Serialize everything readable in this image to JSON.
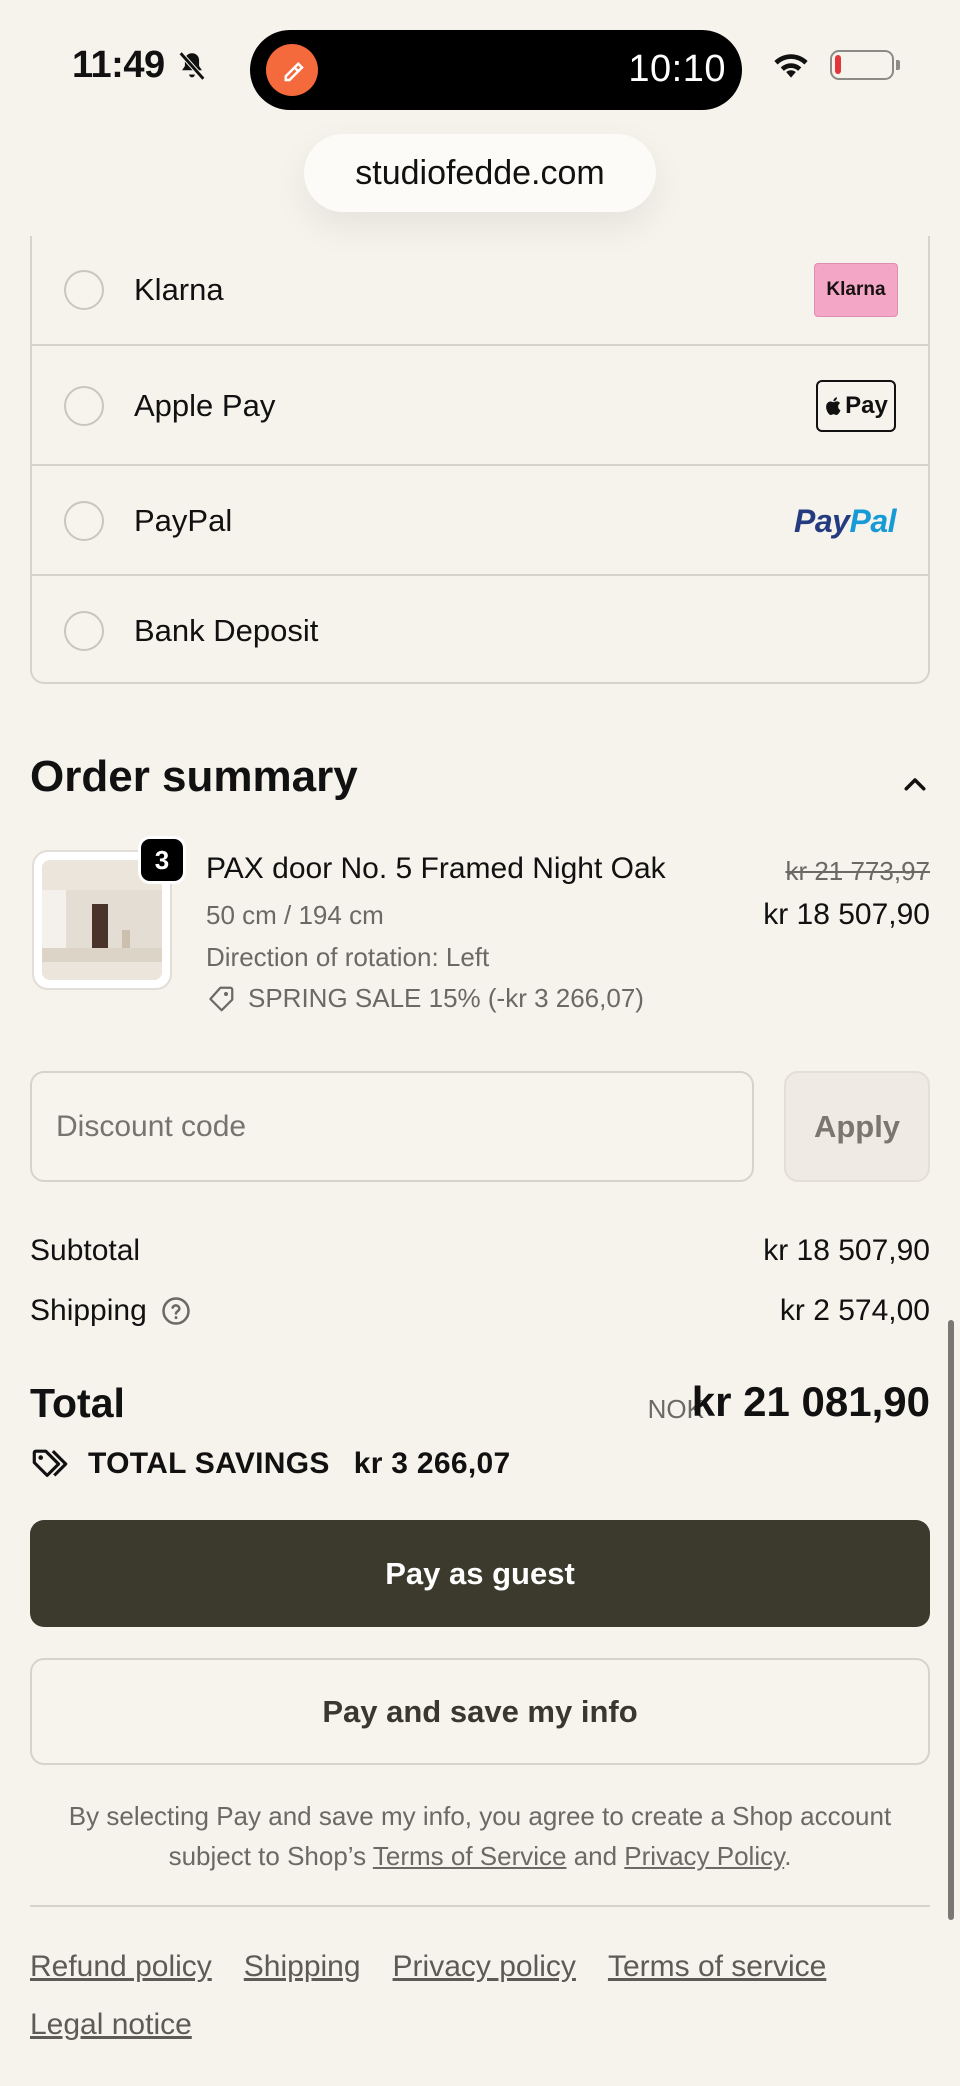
{
  "status_bar": {
    "time": "11:49",
    "timer": "10:10"
  },
  "browser": {
    "url": "studiofedde.com"
  },
  "payment": {
    "methods": [
      {
        "label": "Klarna",
        "badge": "Klarna"
      },
      {
        "label": "Apple Pay",
        "badge": "Pay"
      },
      {
        "label": "PayPal",
        "badge_a": "Pay",
        "badge_b": "Pal"
      },
      {
        "label": "Bank Deposit"
      }
    ]
  },
  "summary": {
    "title": "Order summary",
    "item": {
      "quantity": "3",
      "name": "PAX door No. 5 Framed Night Oak",
      "size": "50 cm / 194 cm",
      "direction": "Direction of rotation: Left",
      "discount": "SPRING SALE 15% (-kr 3 266,07)",
      "price_original": "kr 21 773,97",
      "price_final": "kr 18 507,90"
    },
    "discount": {
      "placeholder": "Discount code",
      "apply_label": "Apply"
    },
    "subtotal_label": "Subtotal",
    "subtotal_value": "kr 18 507,90",
    "shipping_label": "Shipping",
    "shipping_value": "kr 2 574,00",
    "total_label": "Total",
    "total_currency": "NOK",
    "total_value": "kr 21 081,90",
    "savings_label": "TOTAL SAVINGS",
    "savings_value": "kr 3 266,07"
  },
  "actions": {
    "guest_label": "Pay as guest",
    "save_label": "Pay and save my info"
  },
  "consent": {
    "text_before": "By selecting Pay and save my info, you agree to create a Shop account subject to Shop’s ",
    "terms_link": "Terms of Service",
    "and": " and ",
    "privacy_link": "Privacy Policy",
    "period": "."
  },
  "footer": {
    "links": [
      "Refund policy",
      "Shipping",
      "Privacy policy",
      "Terms of service",
      "Legal notice"
    ]
  },
  "colors": {
    "background": "#f6f2ec",
    "primary_button": "#3b3a2c",
    "klarna": "#f4a6c7",
    "paypal_dark": "#253b80",
    "paypal_light": "#179bd7",
    "island_app": "#f56a3c"
  }
}
